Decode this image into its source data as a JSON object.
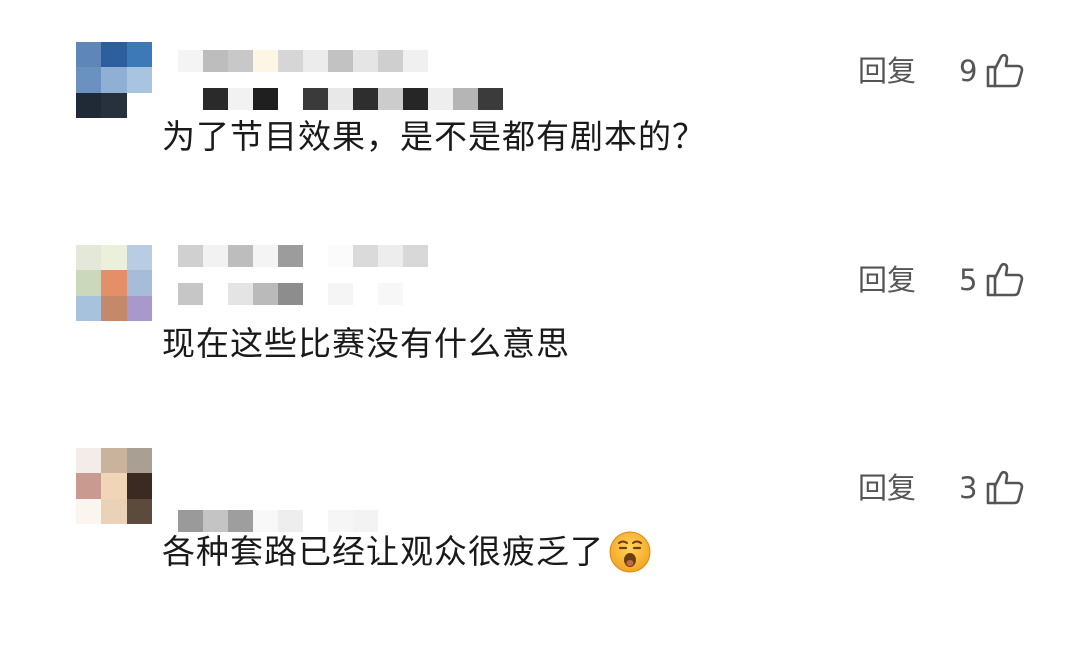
{
  "reply_label": "回复",
  "comments": [
    {
      "text": "为了节目效果，是不是都有剧本的？",
      "likes": "9",
      "avatar": [
        "#5f86b8",
        "#2d5f9e",
        "#3d78b7",
        "#6a91c0",
        "#8fb0d4",
        "#a8c4e0",
        "#1f2a36",
        "#26313c",
        "#ffffff"
      ],
      "name_top": [
        "#f4f4f4",
        "#bdbdbd",
        "#c8c8c8",
        "#fdf6e4",
        "#d6d6d6",
        "#ececec",
        "#c2c2c2",
        "#e5e5e5",
        "#cfcfcf",
        "#f0f0f0"
      ],
      "name_bottom": [
        "#ffffff",
        "#2a2a2a",
        "#f2f2f2",
        "#1f1f1f",
        "#ffffff",
        "#3a3a3a",
        "#e8e8e8",
        "#2e2e2e",
        "#cccccc",
        "#262626",
        "#eeeeee",
        "#b5b5b5",
        "#3b3b3b"
      ]
    },
    {
      "text": "现在这些比赛没有什么意思",
      "likes": "5",
      "avatar": [
        "#e3e8d8",
        "#eaf0dc",
        "#b8cde3",
        "#cbd8bc",
        "#e48e6a",
        "#a7bcd9",
        "#a6c2dd",
        "#c4886a",
        "#a898cc"
      ],
      "name_top": [
        "#d0d0d0",
        "#f2f2f2",
        "#bdbdbd",
        "#f4f4f4",
        "#9c9c9c",
        "#ffffff",
        "#fbfbfb",
        "#dadada",
        "#ededed",
        "#d8d8d8"
      ],
      "name_bottom": [
        "#c6c6c6",
        "#ffffff",
        "#e4e4e4",
        "#bababa",
        "#8d8d8d",
        "#ffffff",
        "#f5f5f5",
        "#ffffff",
        "#f7f7f7",
        "#ffffff"
      ]
    },
    {
      "text": "各种套路已经让观众很疲乏了",
      "likes": "3",
      "avatar": [
        "#f2ede8",
        "#c9b39c",
        "#a99f93",
        "#c99a8f",
        "#f0d6b6",
        "#3a2a22",
        "#fbf5ef",
        "#e9d2b8",
        "#5c4a3d"
      ],
      "name_top": [
        "#ffffff",
        "#ffffff",
        "#ffffff",
        "#ffffff",
        "#ffffff",
        "#ffffff",
        "#ffffff",
        "#ffffff",
        "#ffffff"
      ],
      "name_bottom": [
        "#9a9a9a",
        "#c4c4c4",
        "#9e9e9e",
        "#f8f8f8",
        "#eeeeee",
        "#ffffff",
        "#f6f6f6",
        "#f3f3f3",
        "#ffffff"
      ]
    }
  ],
  "colors": {
    "text": "#1a1a1a",
    "meta": "#555555"
  },
  "icons": {
    "like": "thumbs-up-icon",
    "emoji": "yawning-face-emoji"
  }
}
